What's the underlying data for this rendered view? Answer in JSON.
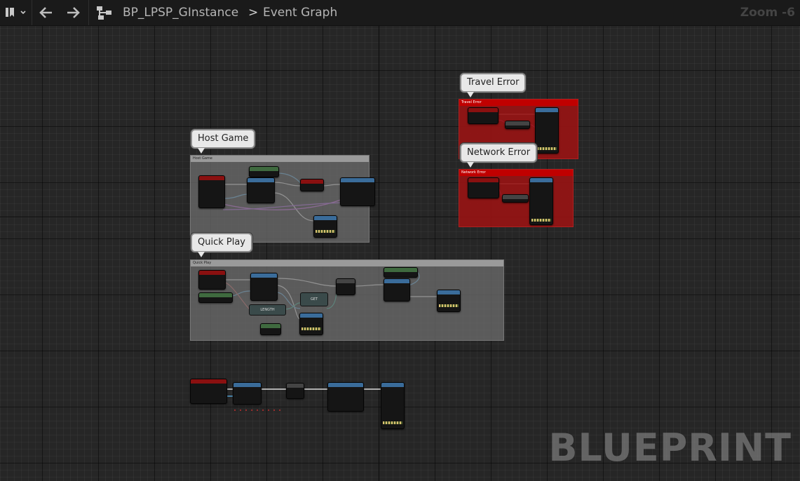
{
  "toolbar": {
    "bookmark_icon": "bookmark-icon",
    "back_icon": "arrow-left-icon",
    "forward_icon": "arrow-right-icon",
    "graph_icon": "blueprint-graph-icon",
    "asset_name": "BP_LPSP_GInstance",
    "separator": ">",
    "graph_name": "Event Graph",
    "zoom": "Zoom -6"
  },
  "graph": {
    "comments": [
      {
        "bubble": "Travel Error",
        "title": "Travel Error",
        "color": "#c00000"
      },
      {
        "bubble": "Network Error",
        "title": "Network Error",
        "color": "#c00000"
      },
      {
        "bubble": "Host Game",
        "title": "Host Game",
        "color": "#9a9a9a"
      },
      {
        "bubble": "Quick Play",
        "title": "Quick Play",
        "color": "#9a9a9a"
      }
    ],
    "nodes": {
      "get": "GET",
      "length": "LENGTH"
    },
    "watermark": "BLUEPRINT"
  }
}
